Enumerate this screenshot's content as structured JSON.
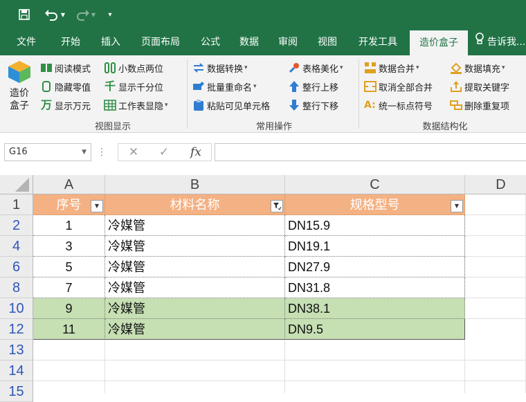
{
  "quick_access": {
    "save_icon": "save-icon",
    "undo_icon": "undo-icon",
    "redo_icon": "redo-icon",
    "customize_icon": "customize-icon"
  },
  "tabs": [
    {
      "label": "文件"
    },
    {
      "label": "开始"
    },
    {
      "label": "插入"
    },
    {
      "label": "页面布局"
    },
    {
      "label": "公式"
    },
    {
      "label": "数据"
    },
    {
      "label": "审阅"
    },
    {
      "label": "视图"
    },
    {
      "label": "开发工具"
    },
    {
      "label": "造价盒子",
      "active": true
    },
    {
      "label": "告诉我..."
    }
  ],
  "ribbon": {
    "big_button": {
      "label_line1": "造价",
      "label_line2": "盒子"
    },
    "view_group": {
      "label": "视图显示",
      "items": [
        "阅读模式",
        "小数点两位",
        "隐藏零值",
        "显示千分位",
        "显示万元",
        "工作表显隐"
      ]
    },
    "ops_group": {
      "label": "常用操作",
      "items": [
        "数据转换",
        "表格美化",
        "批量重命名",
        "整行上移",
        "粘贴可见单元格",
        "整行下移"
      ]
    },
    "struct_group": {
      "label": "数据结构化",
      "items": [
        "数据合并",
        "数据填充",
        "取消全部合并",
        "提取关键字",
        "统一标点符号",
        "删除重复项"
      ]
    }
  },
  "formula_bar": {
    "name_box": "G16",
    "cancel": "✕",
    "confirm": "✓",
    "fx": "fx",
    "value": ""
  },
  "sheet": {
    "columns": [
      "A",
      "B",
      "C",
      "D"
    ],
    "header_row": {
      "row_num": "1",
      "cells": [
        "序号",
        "材料名称",
        "规格型号"
      ]
    },
    "rows": [
      {
        "row_num": "2",
        "cells": [
          "1",
          "冷媒管",
          "DN15.9"
        ],
        "highlight": false
      },
      {
        "row_num": "4",
        "cells": [
          "3",
          "冷媒管",
          "DN19.1"
        ],
        "highlight": false
      },
      {
        "row_num": "6",
        "cells": [
          "5",
          "冷媒管",
          "DN27.9"
        ],
        "highlight": false
      },
      {
        "row_num": "8",
        "cells": [
          "7",
          "冷媒管",
          "DN31.8"
        ],
        "highlight": false
      },
      {
        "row_num": "10",
        "cells": [
          "9",
          "冷媒管",
          "DN38.1"
        ],
        "highlight": true
      },
      {
        "row_num": "12",
        "cells": [
          "11",
          "冷媒管",
          "DN9.5"
        ],
        "highlight": true
      }
    ],
    "extra_rows": [
      "13",
      "14",
      "15"
    ],
    "highlight_color": "#c6dfb3",
    "header_color": "#f4b183",
    "accent": "#217346"
  }
}
